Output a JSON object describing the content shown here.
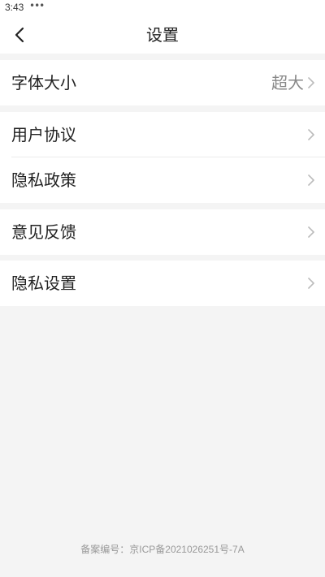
{
  "status_bar": {
    "time": "3:43",
    "notification_dots": "•••"
  },
  "header": {
    "title": "设置",
    "back_icon": "chevron-left-icon"
  },
  "settings": {
    "font_size": {
      "label": "字体大小",
      "value": "超大"
    },
    "user_agreement": {
      "label": "用户协议"
    },
    "privacy_policy": {
      "label": "隐私政策"
    },
    "feedback": {
      "label": "意见反馈"
    },
    "privacy_settings": {
      "label": "隐私设置"
    },
    "row_icon": "chevron-right-icon"
  },
  "footer": {
    "icp": "备案编号：京ICP备2021026251号-7A"
  },
  "colors": {
    "background": "#f4f4f4",
    "surface": "#ffffff",
    "text": "#222222",
    "secondary_text": "#888888",
    "chevron": "#bbbbbb",
    "footer_text": "#999999"
  }
}
